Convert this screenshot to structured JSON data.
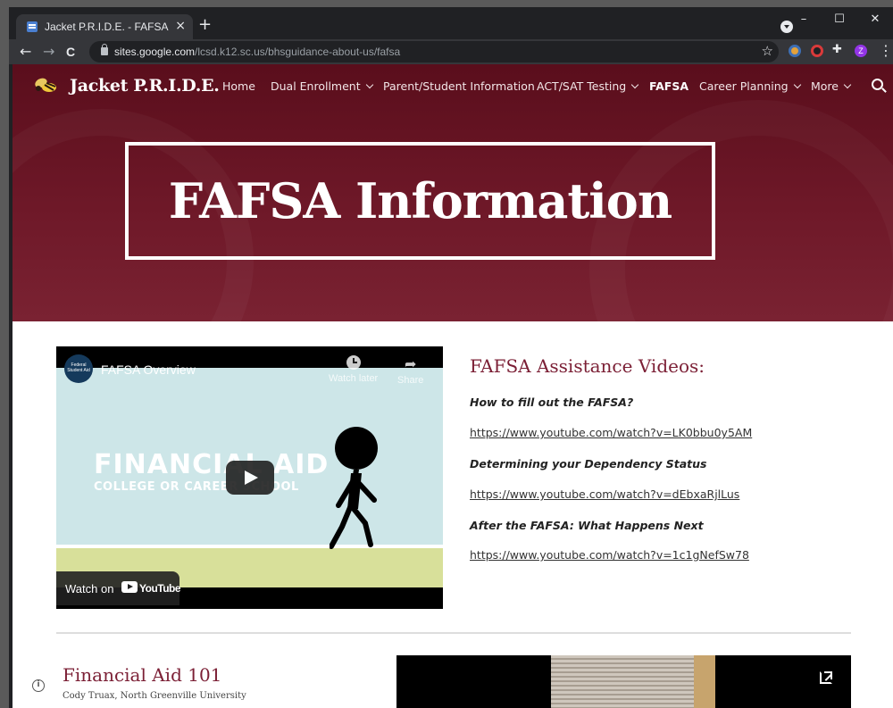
{
  "browser": {
    "tab_title": "Jacket P.R.I.D.E. - FAFSA",
    "tab_close": "×",
    "new_tab": "+",
    "url_host": "sites.google.com",
    "url_path": "/lcsd.k12.sc.us/bhsguidance-about-us/fafsa",
    "profile_initial": "Z",
    "window_controls": {
      "minimize": "–",
      "maximize": "☐",
      "close": "✕"
    },
    "back": "←",
    "forward": "→",
    "reload": "C",
    "star": "☆",
    "menu": "⋮",
    "extensions_icon": "✚"
  },
  "site": {
    "title": "Jacket P.R.I.D.E.",
    "nav": [
      {
        "label": "Home",
        "dropdown": false,
        "active": false
      },
      {
        "label": "Dual Enrollment",
        "dropdown": true,
        "active": false
      },
      {
        "label": "Parent/Student Information",
        "dropdown": false,
        "active": false
      },
      {
        "label": "ACT/SAT Testing",
        "dropdown": true,
        "active": false
      },
      {
        "label": "FAFSA",
        "dropdown": false,
        "active": true
      },
      {
        "label": "Career Planning",
        "dropdown": true,
        "active": false
      },
      {
        "label": "More",
        "dropdown": true,
        "active": false
      }
    ],
    "hero_title": "FAFSA Information",
    "colors": {
      "maroon": "#6e1828",
      "heading": "#7b1f35"
    }
  },
  "video": {
    "title": "FAFSA Overview",
    "channel_lines": "Federal Student Aid",
    "watch_later": "Watch later",
    "share": "Share",
    "share_icon": "➦",
    "caption_line1": "FINANCIAL AID",
    "caption_line2": "COLLEGE OR CAREER SCHOOL",
    "watch_on": "Watch on",
    "youtube": "YouTube"
  },
  "assistance": {
    "heading": "FAFSA Assistance Videos:",
    "items": [
      {
        "question": "How to fill out the FAFSA?",
        "link": "https://www.youtube.com/watch?v=LK0bbu0y5AM"
      },
      {
        "question": "Determining your Dependency Status",
        "link": "https://www.youtube.com/watch?v=dEbxaRjlLus"
      },
      {
        "question": "After the FAFSA: What Happens Next",
        "link": "https://www.youtube.com/watch?v=1c1gNefSw78"
      }
    ]
  },
  "financial_aid": {
    "heading": "Financial Aid 101",
    "byline": "Cody Truax, North Greenville University",
    "info_icon": "i"
  }
}
